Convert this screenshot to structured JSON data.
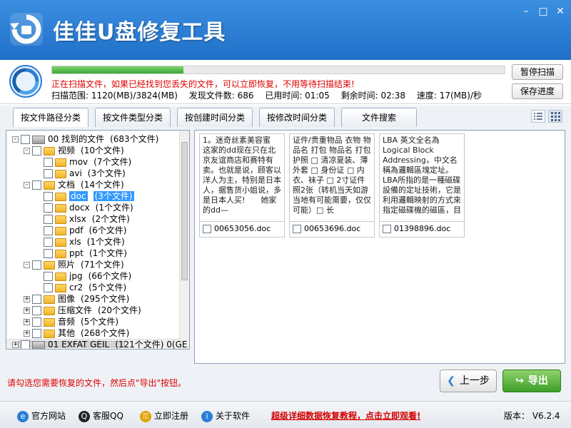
{
  "app": {
    "title": "佳佳U盘修复工具",
    "colors": {
      "titlebar": "#2a7ed4",
      "accent_green": "#3aa936",
      "warning_red": "#e00000"
    }
  },
  "window_controls": {
    "minimize": "–",
    "maximize": "□",
    "close": "✕"
  },
  "scan": {
    "progress_percent": 29,
    "status": "正在扫描文件，如果已经找到您丢失的文件，可以立即恢复，不用等待扫描结束!",
    "range": "扫描范围: 1120(MB)/3824(MB)",
    "found": "发现文件数: 686",
    "elapsed": "已用时间: 01:05",
    "remaining": "剩余时间: 02:38",
    "speed": "速度: 17(MB)/秒",
    "pause_label": "暂停扫描",
    "save_label": "保存进度"
  },
  "tabs": [
    {
      "label": "按文件路径分类",
      "active": true
    },
    {
      "label": "按文件类型分类",
      "active": false
    },
    {
      "label": "按创建时间分类",
      "active": false
    },
    {
      "label": "按修改时间分类",
      "active": false
    },
    {
      "label": "文件搜索",
      "active": false
    }
  ],
  "view_toggle": {
    "list_icon": "list-view-icon",
    "thumb_icon": "thumbnail-view-icon"
  },
  "tree": [
    {
      "name": "00  找到的文件",
      "count": "(683个文件)",
      "type": "drive",
      "level": 0,
      "expander": "-"
    },
    {
      "name": "视频",
      "count": "(10个文件)",
      "type": "folder",
      "level": 1,
      "expander": "-"
    },
    {
      "name": "mov",
      "count": "(7个文件)",
      "type": "folder",
      "level": 2,
      "expander": ""
    },
    {
      "name": "avi",
      "count": "(3个文件)",
      "type": "folder",
      "level": 2,
      "expander": ""
    },
    {
      "name": "文档",
      "count": "(14个文件)",
      "type": "folder",
      "level": 1,
      "expander": "-"
    },
    {
      "name": "doc",
      "count": "(3个文件)",
      "type": "folder",
      "level": 2,
      "expander": "",
      "selected": true
    },
    {
      "name": "docx",
      "count": "(1个文件)",
      "type": "folder",
      "level": 2,
      "expander": ""
    },
    {
      "name": "xlsx",
      "count": "(2个文件)",
      "type": "folder",
      "level": 2,
      "expander": ""
    },
    {
      "name": "pdf",
      "count": "(6个文件)",
      "type": "folder",
      "level": 2,
      "expander": ""
    },
    {
      "name": "xls",
      "count": "(1个文件)",
      "type": "folder",
      "level": 2,
      "expander": ""
    },
    {
      "name": "ppt",
      "count": "(1个文件)",
      "type": "folder",
      "level": 2,
      "expander": ""
    },
    {
      "name": "照片",
      "count": "(71个文件)",
      "type": "folder",
      "level": 1,
      "expander": "-"
    },
    {
      "name": "jpg",
      "count": "(66个文件)",
      "type": "folder",
      "level": 2,
      "expander": ""
    },
    {
      "name": "cr2",
      "count": "(5个文件)",
      "type": "folder",
      "level": 2,
      "expander": ""
    },
    {
      "name": "图像",
      "count": "(295个文件)",
      "type": "folder",
      "level": 1,
      "expander": "+"
    },
    {
      "name": "压缩文件",
      "count": "(20个文件)",
      "type": "folder",
      "level": 1,
      "expander": "+"
    },
    {
      "name": "音频",
      "count": "(5个文件)",
      "type": "folder",
      "level": 1,
      "expander": "+"
    },
    {
      "name": "其他",
      "count": "(268个文件)",
      "type": "folder",
      "level": 1,
      "expander": "+"
    },
    {
      "name": "01  EXFAT GEIL",
      "count": "(121个文件)  0(GE",
      "type": "drive",
      "level": 0,
      "expander": "+"
    }
  ],
  "files": [
    {
      "preview": "1。迷奇丝素美容蜜　　这家的dd现在只在北京友谊商店和赛特有卖。也就是说，顾客以洋人为主，特别是日本人，据售货小姐说，多是日本人买!　　她家的dd—",
      "filename": "00653056.doc"
    },
    {
      "preview": "证件/贵重物品 衣物 物品名 打包 物品名 打包 护照 □ 清凉夏装、薄外套 □ 身份证 □ 内衣、袜子 □ 2寸证件照2张（转机当天如游当地有可能需要，仅仅可能）□ 长",
      "filename": "00653696.doc"
    },
    {
      "preview": "LBA 英文全名為Logical Block Addressing，中文名稱為邏輯區塊定址。LBA所指的是一種磁碟設備的定址技術，它是利用邏輯映射的方式來指定磁碟機的磁區，目前個人",
      "filename": "01398896.doc"
    }
  ],
  "actions": {
    "hint": "请勾选您需要恢复的文件，然后点\"导出\"按钮。",
    "prev_label": "上一步",
    "export_label": "导出"
  },
  "footer": {
    "website": "官方网站",
    "qq": "客服QQ",
    "register": "立即注册",
    "about": "关于软件",
    "promo": "超级详细数据恢复教程，点击立即观看!",
    "version": "版本：  V6.2.4"
  }
}
